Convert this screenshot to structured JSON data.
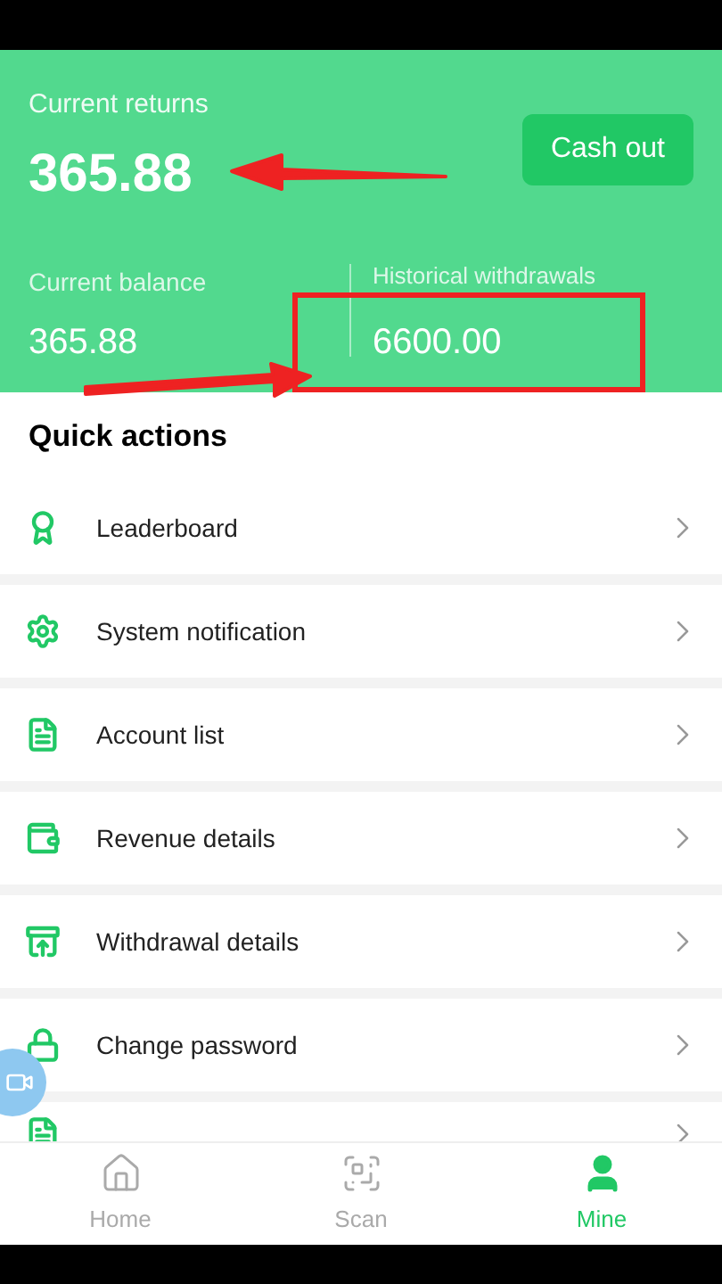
{
  "header": {
    "returns_label": "Current returns",
    "returns_value": "365.88",
    "cash_out": "Cash out",
    "balance_label": "Current balance",
    "balance_value": "365.88",
    "withdrawals_label": "Historical withdrawals",
    "withdrawals_value": "6600.00"
  },
  "quick_actions": {
    "title": "Quick actions",
    "items": [
      {
        "label": "Leaderboard"
      },
      {
        "label": "System notification"
      },
      {
        "label": "Account list"
      },
      {
        "label": "Revenue details"
      },
      {
        "label": "Withdrawal details"
      },
      {
        "label": "Change password"
      }
    ]
  },
  "nav": [
    {
      "label": "Home",
      "selected": false
    },
    {
      "label": "Scan",
      "selected": false
    },
    {
      "label": "Mine",
      "selected": true
    }
  ]
}
